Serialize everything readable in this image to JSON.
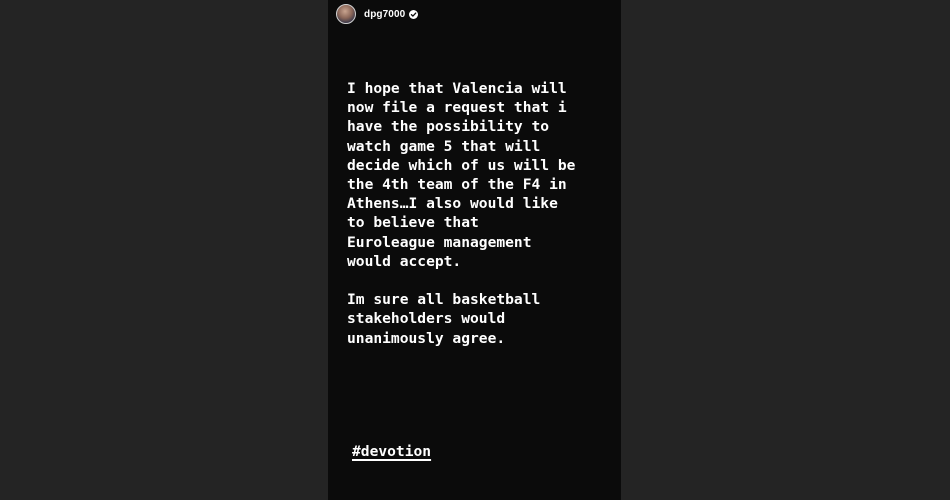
{
  "story": {
    "username": "dpg7000",
    "verified": true,
    "paragraphs": [
      "I hope that Valencia will\nnow file a request that i\nhave the possibility to\nwatch game 5 that will\ndecide which of us will be\nthe 4th team of the F4 in\nAthens…I also would like\nto believe that\nEuroleague management\nwould accept.",
      "Im sure all basketball\nstakeholders would\nunanimously agree."
    ],
    "hashtag": "#devotion"
  },
  "colors": {
    "page_background": "#242424",
    "story_background": "#0b0b0b",
    "text": "#ffffff"
  },
  "icons": [
    "avatar",
    "verified-badge-icon"
  ]
}
